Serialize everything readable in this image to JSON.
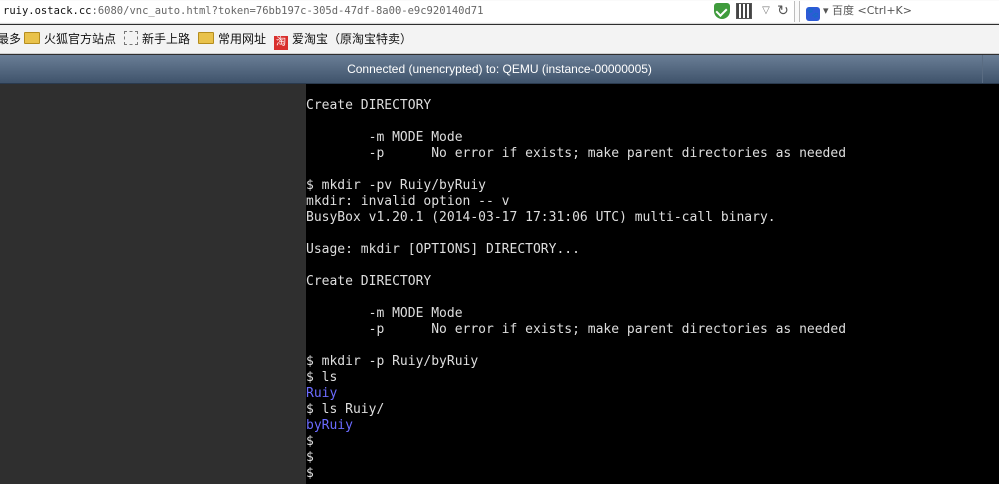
{
  "browser": {
    "url_host": "ruiy.ostack.cc",
    "url_rest": ":6080/vnc_auto.html?token=76bb197c-305d-47df-8a00-e9c920140d71",
    "search_engine": "百度",
    "search_hint": "<Ctrl+K>"
  },
  "bookmarks": [
    {
      "label": "最多",
      "icon": "none"
    },
    {
      "label": "火狐官方站点",
      "icon": "folder-icon"
    },
    {
      "label": "新手上路",
      "icon": "dashed-page-icon"
    },
    {
      "label": "常用网址",
      "icon": "folder-icon"
    },
    {
      "label": "爱淘宝（原淘宝特卖）",
      "icon": "taobao-icon"
    }
  ],
  "taobao_glyph": "淘",
  "vnc": {
    "status": "Connected (unencrypted) to: QEMU (instance-00000005)"
  },
  "terminal": {
    "colors": {
      "text": "#dedede",
      "directory": "#6b6bff",
      "background": "#000000"
    },
    "lines": [
      {
        "text": "Create DIRECTORY",
        "kind": "output"
      },
      {
        "text": "",
        "kind": "output"
      },
      {
        "text": "        -m MODE Mode",
        "kind": "output"
      },
      {
        "text": "        -p      No error if exists; make parent directories as needed",
        "kind": "output"
      },
      {
        "text": "",
        "kind": "output"
      },
      {
        "text": "$ mkdir -pv Ruiy/byRuiy",
        "kind": "output"
      },
      {
        "text": "mkdir: invalid option -- v",
        "kind": "output"
      },
      {
        "text": "BusyBox v1.20.1 (2014-03-17 17:31:06 UTC) multi-call binary.",
        "kind": "output"
      },
      {
        "text": "",
        "kind": "output"
      },
      {
        "text": "Usage: mkdir [OPTIONS] DIRECTORY...",
        "kind": "output"
      },
      {
        "text": "",
        "kind": "output"
      },
      {
        "text": "Create DIRECTORY",
        "kind": "output"
      },
      {
        "text": "",
        "kind": "output"
      },
      {
        "text": "        -m MODE Mode",
        "kind": "output"
      },
      {
        "text": "        -p      No error if exists; make parent directories as needed",
        "kind": "output"
      },
      {
        "text": "",
        "kind": "output"
      },
      {
        "text": "$ mkdir -p Ruiy/byRuiy",
        "kind": "output"
      },
      {
        "text": "$ ls",
        "kind": "output"
      },
      {
        "text": "Ruiy",
        "kind": "dir"
      },
      {
        "text": "$ ls Ruiy/",
        "kind": "output"
      },
      {
        "text": "byRuiy",
        "kind": "dir"
      },
      {
        "text": "$",
        "kind": "output"
      },
      {
        "text": "$",
        "kind": "output"
      },
      {
        "text": "$",
        "kind": "output"
      }
    ]
  }
}
